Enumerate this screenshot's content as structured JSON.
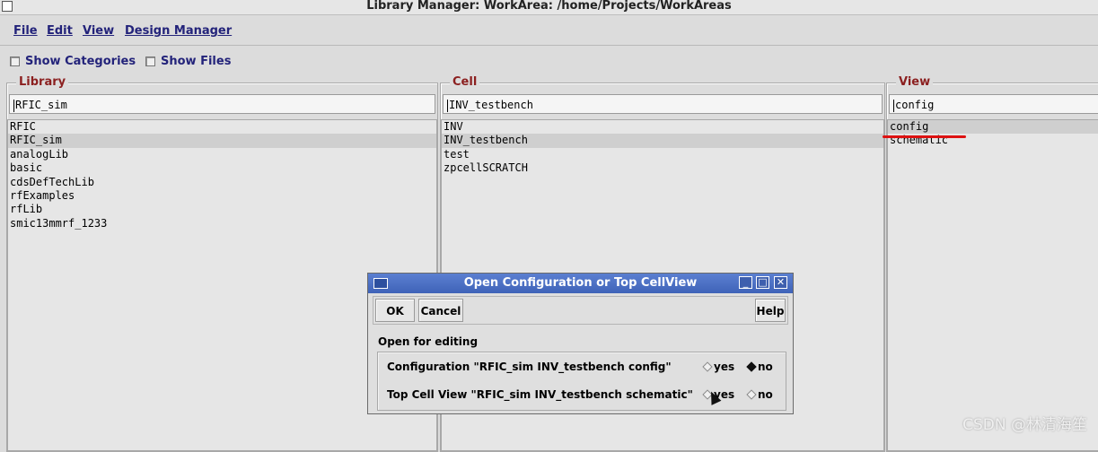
{
  "window": {
    "title": "Library Manager: WorkArea: /home/Projects/WorkAreas"
  },
  "menubar": {
    "items": [
      "File",
      "Edit",
      "View",
      "Design Manager"
    ]
  },
  "options": {
    "show_categories": "Show Categories",
    "show_files": "Show Files"
  },
  "library": {
    "label": "Library",
    "filter": "RFIC_sim",
    "items": [
      "RFIC",
      "RFIC_sim",
      "analogLib",
      "basic",
      "cdsDefTechLib",
      "rfExamples",
      "rfLib",
      "smic13mmrf_1233"
    ],
    "selected": "RFIC_sim"
  },
  "cell": {
    "label": "Cell",
    "filter": "INV_testbench",
    "items": [
      "INV",
      "INV_testbench",
      "test",
      "zpcellSCRATCH"
    ],
    "selected": "INV_testbench"
  },
  "view": {
    "label": "View",
    "filter": "config",
    "items": [
      "config",
      "schematic"
    ],
    "selected": "config"
  },
  "dialog": {
    "title": "Open Configuration or Top CellView",
    "ok": "OK",
    "cancel": "Cancel",
    "help": "Help",
    "section_label": "Open for editing",
    "rows": [
      {
        "label": "Configuration \"RFIC_sim INV_testbench config\"",
        "yes": "yes",
        "no": "no",
        "selected": "no"
      },
      {
        "label": "Top Cell View \"RFIC_sim INV_testbench schematic\"",
        "yes": "yes",
        "no": "no",
        "selected": "none"
      }
    ]
  },
  "watermark": "CSDN @林清海笙",
  "colors": {
    "menu_text": "#23237a",
    "panel_label": "#8b1f1f",
    "dialog_titlebar": "#4a6fc4",
    "annotation_underline": "#d11111"
  }
}
